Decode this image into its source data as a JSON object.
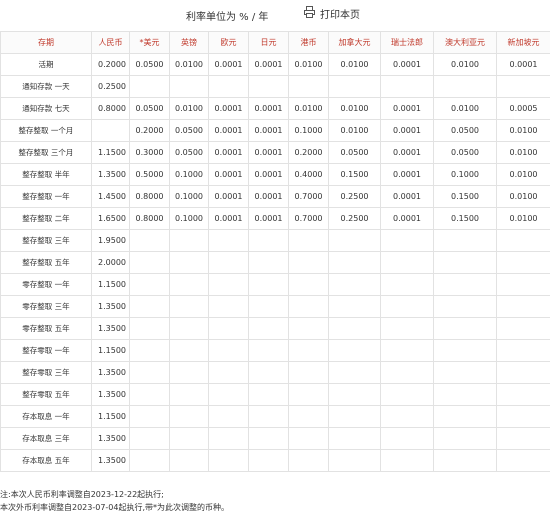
{
  "header": {
    "unit_label": "利率单位为 % / 年",
    "print_label": "打印本页"
  },
  "columns": [
    "存期",
    "人民币",
    "*美元",
    "英镑",
    "欧元",
    "日元",
    "港币",
    "加拿大元",
    "瑞士法郎",
    "澳大利亚元",
    "新加坡元"
  ],
  "rows": [
    [
      "活期",
      "0.2000",
      "0.0500",
      "0.0100",
      "0.0001",
      "0.0001",
      "0.0100",
      "0.0100",
      "0.0001",
      "0.0100",
      "0.0001"
    ],
    [
      "通知存款 一天",
      "0.2500",
      "",
      "",
      "",
      "",
      "",
      "",
      "",
      "",
      ""
    ],
    [
      "通知存款 七天",
      "0.8000",
      "0.0500",
      "0.0100",
      "0.0001",
      "0.0001",
      "0.0100",
      "0.0100",
      "0.0001",
      "0.0100",
      "0.0005"
    ],
    [
      "整存整取 一个月",
      "",
      "0.2000",
      "0.0500",
      "0.0001",
      "0.0001",
      "0.1000",
      "0.0100",
      "0.0001",
      "0.0500",
      "0.0100"
    ],
    [
      "整存整取 三个月",
      "1.1500",
      "0.3000",
      "0.0500",
      "0.0001",
      "0.0001",
      "0.2000",
      "0.0500",
      "0.0001",
      "0.0500",
      "0.0100"
    ],
    [
      "整存整取 半年",
      "1.3500",
      "0.5000",
      "0.1000",
      "0.0001",
      "0.0001",
      "0.4000",
      "0.1500",
      "0.0001",
      "0.1000",
      "0.0100"
    ],
    [
      "整存整取 一年",
      "1.4500",
      "0.8000",
      "0.1000",
      "0.0001",
      "0.0001",
      "0.7000",
      "0.2500",
      "0.0001",
      "0.1500",
      "0.0100"
    ],
    [
      "整存整取 二年",
      "1.6500",
      "0.8000",
      "0.1000",
      "0.0001",
      "0.0001",
      "0.7000",
      "0.2500",
      "0.0001",
      "0.1500",
      "0.0100"
    ],
    [
      "整存整取 三年",
      "1.9500",
      "",
      "",
      "",
      "",
      "",
      "",
      "",
      "",
      ""
    ],
    [
      "整存整取 五年",
      "2.0000",
      "",
      "",
      "",
      "",
      "",
      "",
      "",
      "",
      ""
    ],
    [
      "零存整取 一年",
      "1.1500",
      "",
      "",
      "",
      "",
      "",
      "",
      "",
      "",
      ""
    ],
    [
      "零存整取 三年",
      "1.3500",
      "",
      "",
      "",
      "",
      "",
      "",
      "",
      "",
      ""
    ],
    [
      "零存整取 五年",
      "1.3500",
      "",
      "",
      "",
      "",
      "",
      "",
      "",
      "",
      ""
    ],
    [
      "整存零取 一年",
      "1.1500",
      "",
      "",
      "",
      "",
      "",
      "",
      "",
      "",
      ""
    ],
    [
      "整存零取 三年",
      "1.3500",
      "",
      "",
      "",
      "",
      "",
      "",
      "",
      "",
      ""
    ],
    [
      "整存零取 五年",
      "1.3500",
      "",
      "",
      "",
      "",
      "",
      "",
      "",
      "",
      ""
    ],
    [
      "存本取息 一年",
      "1.1500",
      "",
      "",
      "",
      "",
      "",
      "",
      "",
      "",
      ""
    ],
    [
      "存本取息 三年",
      "1.3500",
      "",
      "",
      "",
      "",
      "",
      "",
      "",
      "",
      ""
    ],
    [
      "存本取息 五年",
      "1.3500",
      "",
      "",
      "",
      "",
      "",
      "",
      "",
      "",
      ""
    ]
  ],
  "notes": [
    "注:本次人民币利率调整自2023-12-22起执行;",
    "本次外币利率调整自2023-07-04起执行,带*为此次调整的币种。"
  ],
  "colors": {
    "header_text": "#c0392b",
    "border": "#e2e2e2",
    "body_text": "#333333"
  }
}
